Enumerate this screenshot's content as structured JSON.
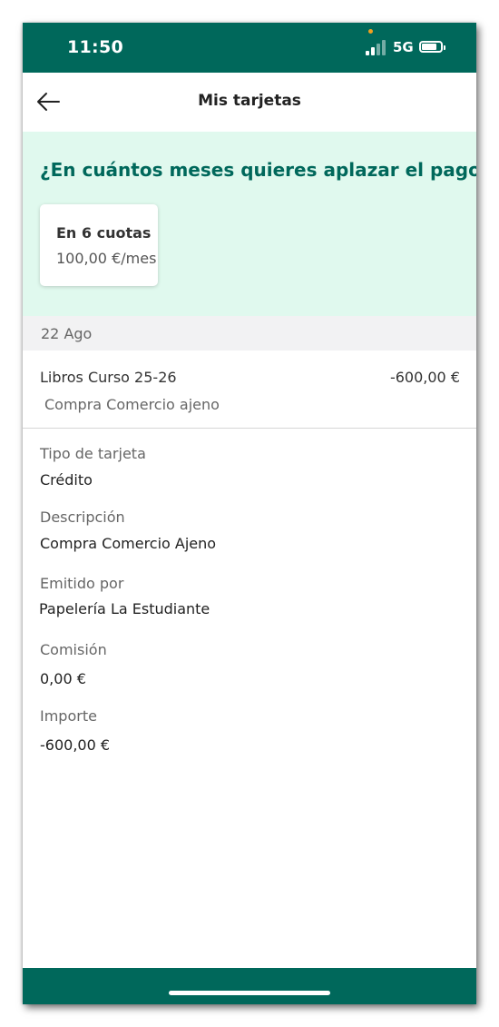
{
  "status_bar": {
    "time": "11:50",
    "network": "5G"
  },
  "header": {
    "title": "Mis tarjetas",
    "back_icon": "arrow-left-icon"
  },
  "installments": {
    "question": "¿En cuántos meses quieres aplazar el pago?",
    "option": {
      "title": "En 6 cuotas",
      "amount": "100,00 €/mes"
    }
  },
  "transaction": {
    "date": "22 Ago",
    "title": "Libros Curso 25-26",
    "amount": "-600,00 €",
    "subtitle": "Compra Comercio ajeno"
  },
  "details": [
    {
      "label": "Tipo de tarjeta",
      "value": "Crédito"
    },
    {
      "label": "Descripción",
      "value": "Compra Comercio Ajeno"
    },
    {
      "label": "Emitido por",
      "value": "Papelería La Estudiante"
    },
    {
      "label": "Comisión",
      "value": "0,00 €"
    },
    {
      "label": "Importe",
      "value": "-600,00 €"
    }
  ],
  "colors": {
    "brand": "#00685b",
    "promo_bg": "#e0f9ee",
    "date_bg": "#f2f2f3"
  }
}
